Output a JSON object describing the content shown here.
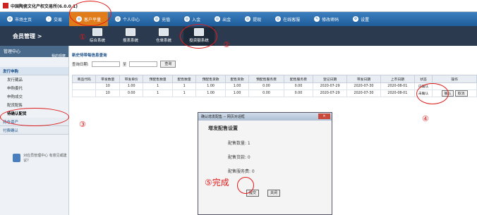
{
  "app_title": "中国陶瓷文化产权交易所(6.0.0.1)",
  "topnav": [
    {
      "label": "市场主页"
    },
    {
      "label": "交易"
    },
    {
      "label": "客户平量"
    },
    {
      "label": "个人中心"
    },
    {
      "label": "充值"
    },
    {
      "label": "入金"
    },
    {
      "label": "出金"
    },
    {
      "label": "提现"
    },
    {
      "label": "在线客服"
    },
    {
      "label": "修改密码"
    },
    {
      "label": "设置"
    }
  ],
  "subbar": {
    "title": "会员管理  >",
    "systems": [
      "综合系统",
      "报表系统",
      "仓单系统",
      "投资额系统"
    ]
  },
  "sidebar": {
    "head": "管理中心",
    "head_sub": "我的观摩",
    "section": "发行申购",
    "items": [
      "发行藏品",
      "申购委托",
      "申购成交",
      "配货配售",
      "待确认配货"
    ],
    "section2": "持仓资产",
    "section3": "付费确认",
    "help": "对应员管理中心 有意见或建议?"
  },
  "filter": {
    "title": "新史待带每信息查询",
    "date_label": "查询日期:",
    "to": "至",
    "query": "查询"
  },
  "table": {
    "headers": [
      "商品代码",
      "带发数量",
      "带发单价",
      "预配售数量",
      "配售数量",
      "预配售货款",
      "配售货款",
      "预配售服务费",
      "配售服务费",
      "登记日期",
      "带发日期",
      "上市日期",
      "状态",
      "操作"
    ],
    "rows": [
      [
        "",
        "10",
        "1.00",
        "1",
        "1",
        "1.00",
        "1.00",
        "0.00",
        "0.00",
        "2020-07-29",
        "2020-07-30",
        "2020-08-01",
        "已确认",
        ""
      ],
      [
        "",
        "10",
        "0.00",
        "1",
        "1",
        "1.00",
        "1.00",
        "0.00",
        "0.00",
        "2020-07-29",
        "2020-07-30",
        "2020-08-01",
        "未确认",
        ""
      ]
    ],
    "confirm": "确认",
    "cancel": "取消"
  },
  "dialog": {
    "title": "确认增发配售 -- 网页对话框",
    "heading": "增发配售设置",
    "qty": "配售数量: 1",
    "amount": "配售货款: 0",
    "fee": "配售服务费: 0",
    "submit": "提交",
    "close": "关闭"
  },
  "annotations": [
    "①",
    "②",
    "③",
    "④",
    "⑤完成"
  ]
}
